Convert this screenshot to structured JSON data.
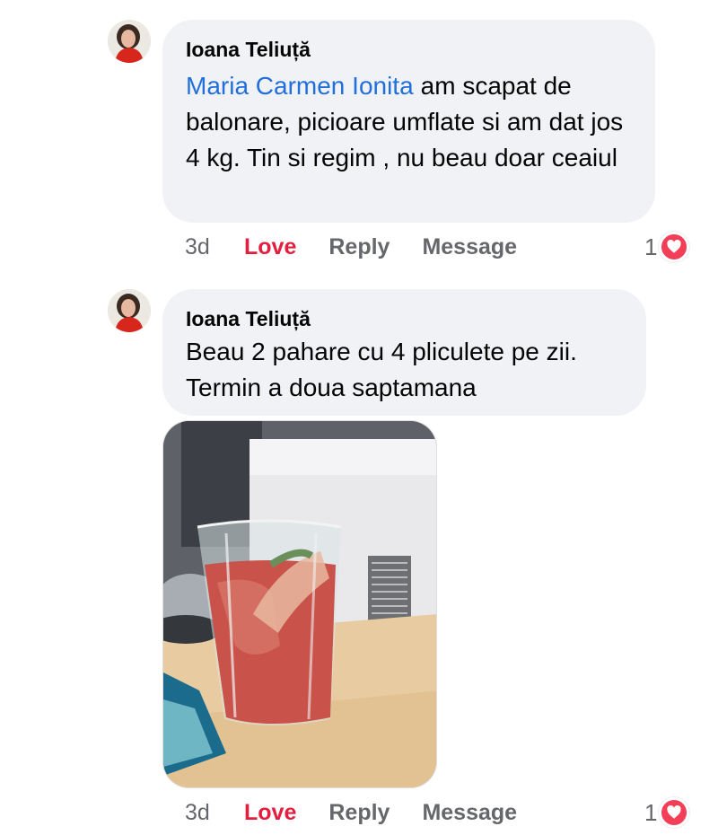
{
  "comments": [
    {
      "author": "Ioana Teliuță",
      "mention": "Maria Carmen Ionita",
      "text": "am scapat de balonare, picioare umflate si am dat jos 4 kg. Tin si regim , nu beau doar ceaiul",
      "time": "3d",
      "love_label": "Love",
      "reply_label": "Reply",
      "message_label": "Message",
      "reaction_count": "1",
      "reaction_icon": "heart-icon"
    },
    {
      "author": "Ioana Teliuță",
      "text": "Beau 2 pahare cu 4 pliculete pe zii. Termin a doua saptamana",
      "time": "3d",
      "love_label": "Love",
      "reply_label": "Reply",
      "message_label": "Message",
      "reaction_count": "1",
      "reaction_icon": "heart-icon"
    }
  ],
  "colors": {
    "bubble": "#f0f2f5",
    "love": "#e41e3f",
    "mention": "#216fdb",
    "muted": "#65676b",
    "heart": "#f33e58"
  }
}
